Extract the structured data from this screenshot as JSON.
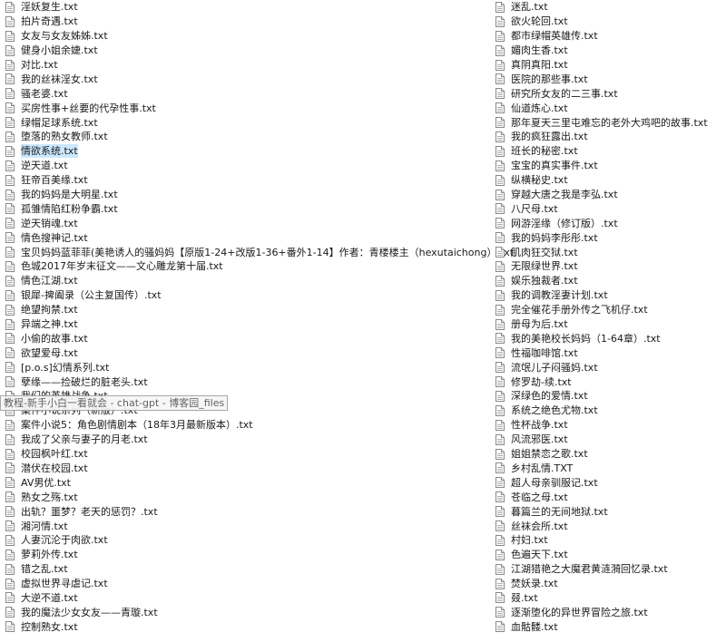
{
  "left_files": [
    "淫妖复生.txt",
    "拍片奇遇.txt",
    "女友与女友姊姊.txt",
    "健身小姐余婕.txt",
    "对比.txt",
    "我的丝袜淫女.txt",
    "骚老婆.txt",
    "买房性事+丝要的代孕性事.txt",
    "绿帽足球系统.txt",
    "堕落的熟女教师.txt",
    "情欲系统.txt",
    "逆天道.txt",
    "狂帝百美缘.txt",
    "我的妈妈是大明星.txt",
    "孤雏情陷红粉争霸.txt",
    "逆天销魂.txt",
    "情色搜神记.txt",
    "宝贝妈妈蓝菲菲(美艳诱人的骚妈妈【原版1-24+改版1-36+番外1-14】作者：青楼楼主（hexutaichong）.txt",
    "色城2017年岁末征文——文心雕龙第十届.txt",
    "情色江湖.txt",
    "银犀-捭阖录（公主复国传）.txt",
    "绝望拘禁.txt",
    "异端之神.txt",
    "小偷的故事.txt",
    "欲望爱母.txt",
    "[p.o.s]幻情系列.txt",
    "孽缘——捡破烂的脏老头.txt",
    "我们的英雄战争.txt",
    "案件小说系列（新版）.txt",
    "案件小说5：角色剧情剧本（18年3月最新版本）.txt",
    "我成了父亲与妻子的月老.txt",
    "校园枫叶红.txt",
    "潜伏在校园.txt",
    "AV男优.txt",
    "熟女之殇.txt",
    "出轨？噩梦？老天的惩罚？.txt",
    "湘河情.txt",
    "人妻沉沦于肉欲.txt",
    "萝莉外传.txt",
    "错之乱.txt",
    "虚拟世界寻虐记.txt",
    "大逆不道.txt",
    "我的魔法少女女友——青璇.txt",
    "控制熟女.txt"
  ],
  "right_files": [
    "迷乱.txt",
    "欲火轮回.txt",
    "都市绿帽英雄传.txt",
    "媚肉生香.txt",
    "真阴真阳.txt",
    "医院的那些事.txt",
    "研究所女友的二三事.txt",
    "仙道炼心.txt",
    "那年夏天三里屯难忘的老外大鸡吧的故事.txt",
    "我的疯狂露出.txt",
    "班长的秘密.txt",
    "宝宝的真实事件.txt",
    "纵横秘史.txt",
    "穿越大唐之我是李弘.txt",
    "八尺母.txt",
    "网游淫缘（修订版）.txt",
    "我的妈妈李彤彤.txt",
    "肌肉狂交狱.txt",
    "无限绿世界.txt",
    "娱乐独裁者.txt",
    "我的调教淫妻计划.txt",
    "完全催花手册外传之飞机仔.txt",
    "册母为后.txt",
    "我的美艳校长妈妈（1-64章）.txt",
    "性福咖啡馆.txt",
    "流氓儿子闷骚妈.txt",
    "修罗劫-续.txt",
    "深绿色的爱情.txt",
    "系统之绝色尤物.txt",
    "性杯战争.txt",
    "风流邪医.txt",
    "姐姐禁恋之歌.txt",
    "乡村乱情.TXT",
    "超人母亲驯服记.txt",
    "苍临之母.txt",
    "暮篇兰的无间地狱.txt",
    "丝袜会所.txt",
    "村妇.txt",
    "色遍天下.txt",
    "江湖猎艳之大魔君黄涟漪回忆录.txt",
    "焚妖录.txt",
    "叕.txt",
    "逐渐堕化的异世界冒险之旅.txt",
    "血骷髅.txt"
  ],
  "selected_left_index": 10,
  "tooltip": "教程-新手小白一看就会 - chat-gpt - 博客园_files",
  "icon": "text-file-icon",
  "colors": {
    "selection": "#cce8ff",
    "tooltip_bg": "#f7f7f7",
    "tooltip_border": "#a0a0a0"
  }
}
